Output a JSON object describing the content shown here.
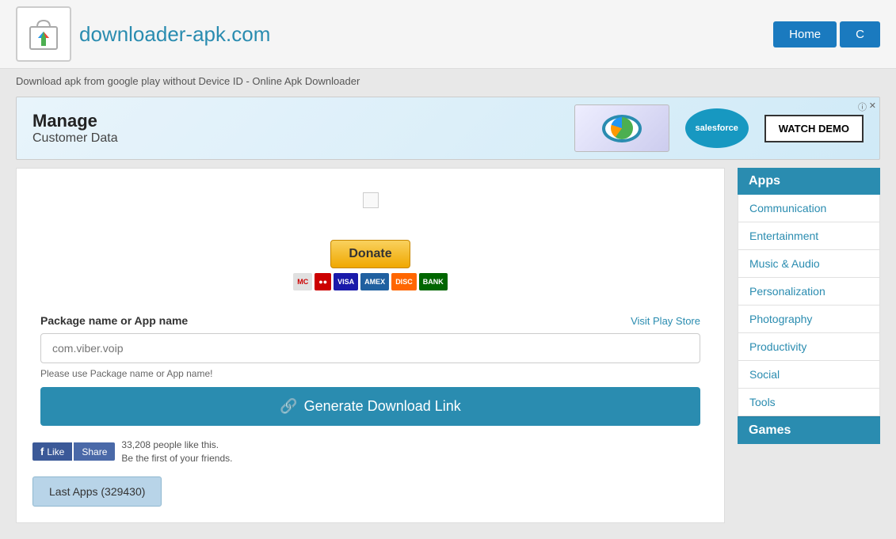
{
  "header": {
    "site_name": "downloader-apk.com",
    "nav_buttons": [
      "Home",
      "C"
    ]
  },
  "breadcrumb": {
    "text": "Download apk from google play without Device ID - Online Apk Downloader"
  },
  "ad": {
    "manage": "Manage",
    "customer_data": "Customer Data",
    "salesforce_label": "salesforce",
    "watch_demo": "WATCH DEMO",
    "close": "x",
    "info": "i"
  },
  "donate": {
    "button_label": "Donate",
    "payment_methods": [
      "MC",
      "VISA",
      "AMEX",
      "DISC",
      "BANK"
    ]
  },
  "form": {
    "label": "Package name or App name",
    "visit_store": "Visit Play Store",
    "placeholder": "com.viber.voip",
    "hint": "Please use Package name or App name!",
    "generate_button": "Generate Download Link"
  },
  "facebook": {
    "like_label": "Like",
    "share_label": "Share",
    "people_text": "33,208 people like this.",
    "friend_text": "Be the first of your friends."
  },
  "last_apps_button": "Last Apps (329430)",
  "sidebar": {
    "apps_title": "Apps",
    "items": [
      {
        "label": "Communication"
      },
      {
        "label": "Entertainment"
      },
      {
        "label": "Music & Audio"
      },
      {
        "label": "Personalization"
      },
      {
        "label": "Photography"
      },
      {
        "label": "Productivity"
      },
      {
        "label": "Social"
      },
      {
        "label": "Tools"
      }
    ],
    "games_title": "Games"
  }
}
